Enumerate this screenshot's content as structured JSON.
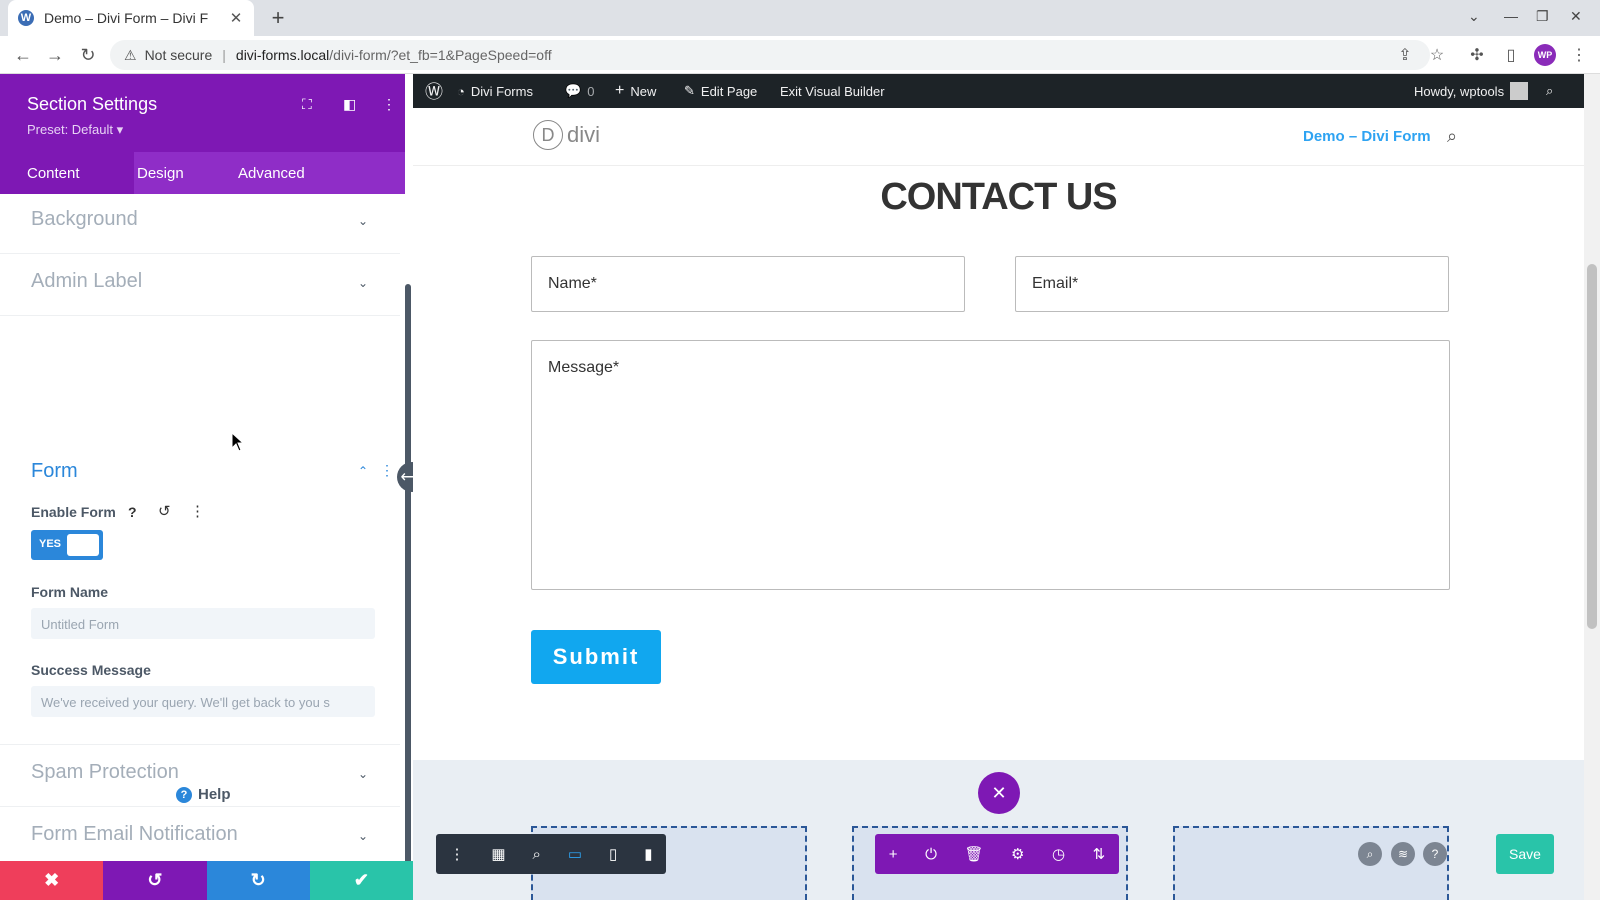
{
  "browser": {
    "tab_title": "Demo – Divi Form – Divi F",
    "tab_favicon": "wordpress-icon",
    "security_label": "Not secure",
    "url_host": "divi-forms.local",
    "url_path": "/divi-form/?et_fb=1&PageSpeed=off",
    "profile_initials": "WP"
  },
  "panel": {
    "title": "Section Settings",
    "preset": "Preset: Default ▾",
    "tabs": [
      "Content",
      "Design",
      "Advanced"
    ],
    "groups": {
      "background": "Background",
      "admin_label": "Admin Label",
      "form": "Form",
      "spam": "Spam Protection",
      "email": "Form Email Notification"
    },
    "fields": {
      "enable_form_label": "Enable Form",
      "enable_form_value": "YES",
      "form_name_label": "Form Name",
      "form_name_placeholder": "Untitled Form",
      "success_label": "Success Message",
      "success_placeholder": "We've received your query. We'll get back to you s"
    },
    "help": "Help",
    "colors": {
      "purple": "#7e18b4",
      "blue": "#2b87da",
      "red": "#ef3e5b",
      "green": "#29c4a9"
    }
  },
  "adminbar": {
    "site": "Divi Forms",
    "comments": "0",
    "new": "New",
    "edit": "Edit Page",
    "exit": "Exit Visual Builder",
    "howdy": "Howdy, wptools"
  },
  "site": {
    "logo_letter": "D",
    "logo_text": "divi",
    "menu_item": "Demo – Divi Form",
    "heading": "CONTACT US",
    "name_field": "Name*",
    "email_field": "Email*",
    "message_field": "Message*",
    "submit": "Submit",
    "save": "Save"
  }
}
